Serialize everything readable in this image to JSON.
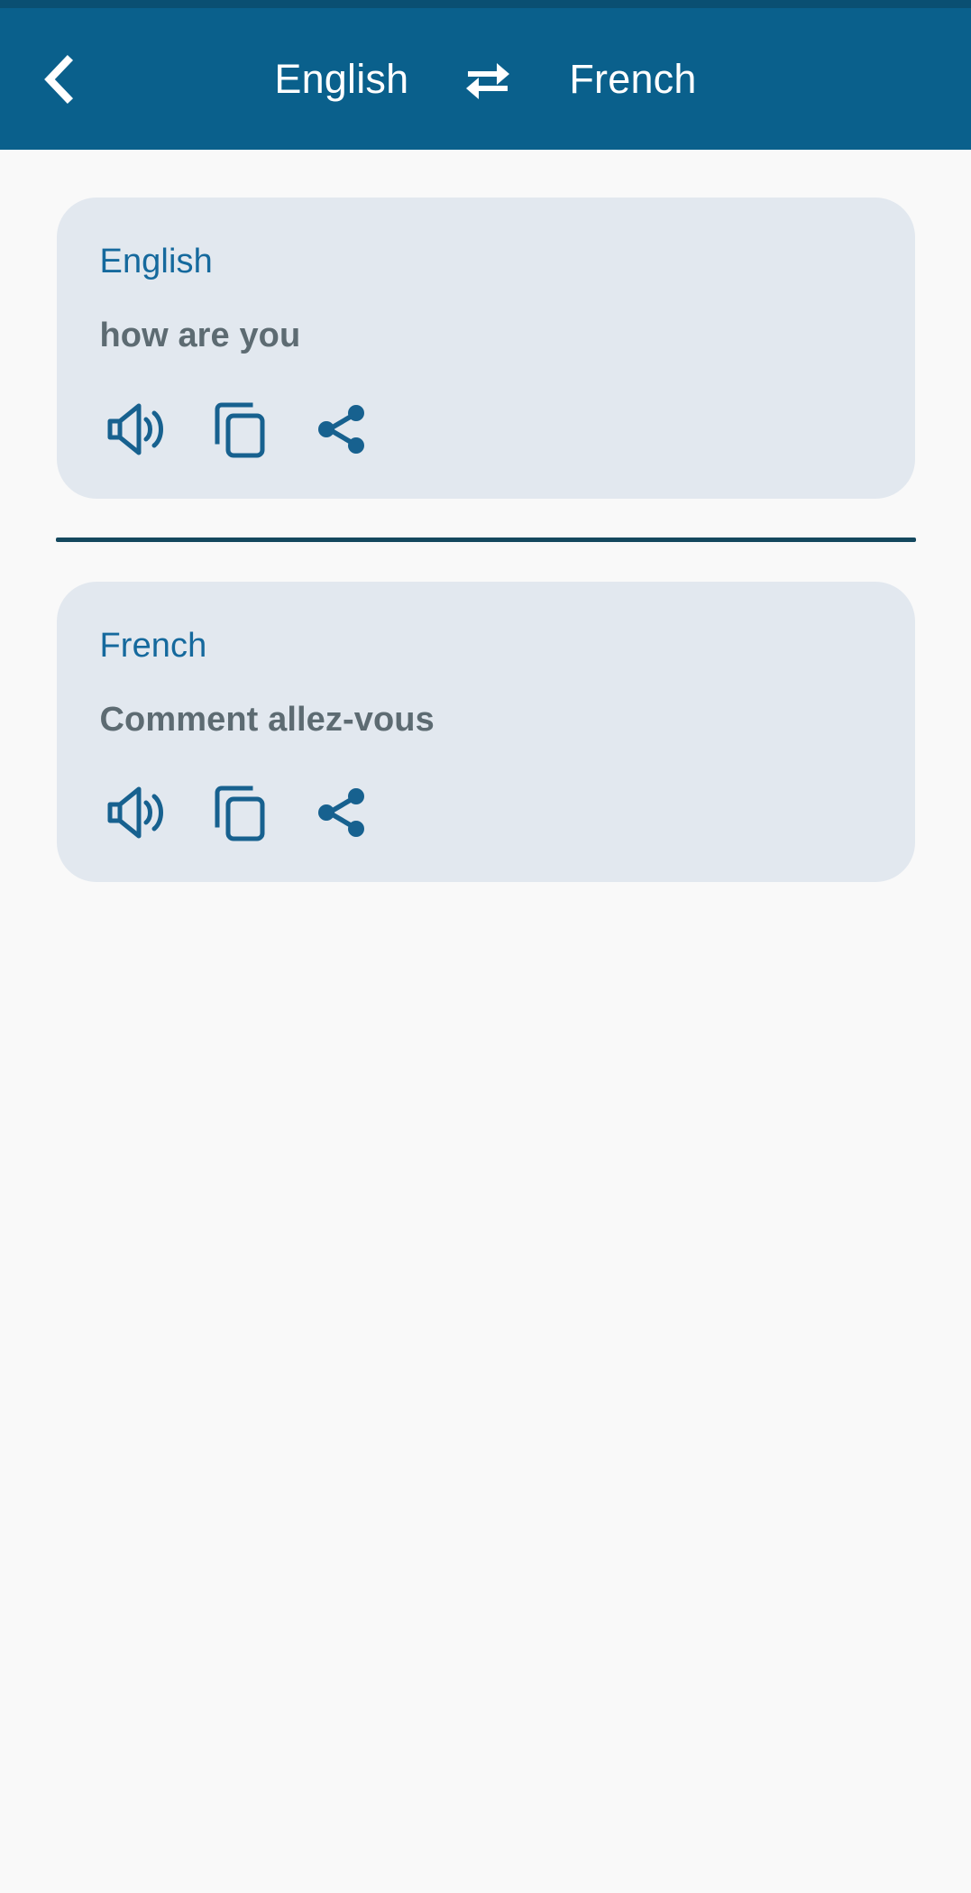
{
  "app": {
    "accent_blue": "#0a608c",
    "status_bar_color": "#0a4f72",
    "page_background": "#f9f9f9",
    "card_background": "#e2e8ef",
    "card_label_color": "#15699d",
    "card_text_color": "#5d6b72",
    "divider_color": "#14485e",
    "icon_color": "#17618f"
  },
  "header": {
    "back_icon": "chevron-left-icon",
    "source_language": "English",
    "swap_icon": "swap-horizontal-arrows-icon",
    "target_language": "French"
  },
  "cards": [
    {
      "language_label": "English",
      "text": "how are you",
      "actions": [
        {
          "name": "speak-button",
          "icon": "speaker-volume-icon"
        },
        {
          "name": "copy-button",
          "icon": "copy-icon"
        },
        {
          "name": "share-button",
          "icon": "share-icon"
        }
      ]
    },
    {
      "language_label": "French",
      "text": "Comment allez-vous",
      "actions": [
        {
          "name": "speak-button",
          "icon": "speaker-volume-icon"
        },
        {
          "name": "copy-button",
          "icon": "copy-icon"
        },
        {
          "name": "share-button",
          "icon": "share-icon"
        }
      ]
    }
  ]
}
